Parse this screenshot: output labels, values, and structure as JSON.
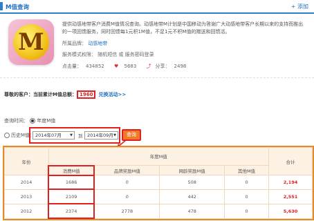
{
  "header": {
    "title": "M值查询",
    "add_label": "+ 添加"
  },
  "app": {
    "icon_letter": "M",
    "description": "提供动感地带客户消费M值情况查询。动感地带M计划是中国移动为答谢广大动感地带客户长期以来的支持而推出的一项回馈服务，同时回馈每1元积1M值，不足1元不积M值的赠送和回馈活。",
    "brand_label": "所属品牌：",
    "brand_value": "动感地带",
    "mode_label": "服务模式权限：",
    "mode_value": "随机短信 或 服务密码登录",
    "clicks_label": "点击量：",
    "clicks_value": "434852",
    "likes_value": "5683",
    "share_label": "分享：",
    "share_value": "2498"
  },
  "summary": {
    "prefix": "尊敬的客户：当前累计M值总额：",
    "total": "1960",
    "link": "兑换活动>>"
  },
  "query": {
    "time_label": "查询时间：",
    "option_year": "年度M值",
    "option_history": "历史M值：",
    "start_month": "2014年07月",
    "to_label": "到",
    "end_month": "2014年09月",
    "submit": "查询"
  },
  "table": {
    "col_year": "年份",
    "group_header": "年度M值",
    "col_consume": "消费M值",
    "col_brand_reward": "品牌奖励M值",
    "col_network_reward": "网龄奖励M值",
    "col_other": "其他M值",
    "col_total": "合计",
    "rows": [
      {
        "year": "2014",
        "consume": "1686",
        "brand": "0",
        "network": "508",
        "other": "0",
        "total": "2,194"
      },
      {
        "year": "2013",
        "consume": "2109",
        "brand": "0",
        "network": "442",
        "other": "0",
        "total": "2,551"
      },
      {
        "year": "2012",
        "consume": "2374",
        "brand": "2778",
        "network": "478",
        "other": "0",
        "total": "5,630"
      }
    ]
  }
}
